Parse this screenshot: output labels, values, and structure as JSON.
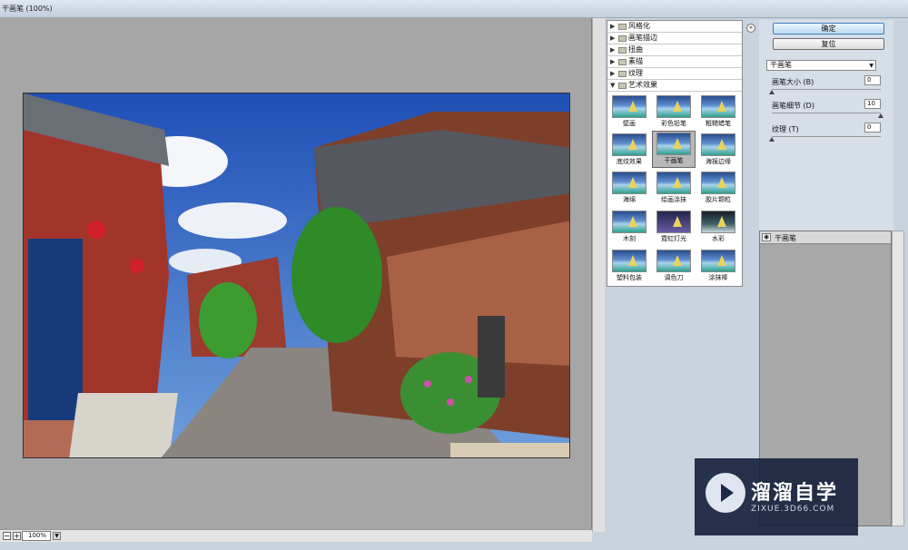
{
  "window": {
    "title": "干画笔 (100%)"
  },
  "zoom": {
    "value": "100%"
  },
  "gallery": {
    "categories": [
      "风格化",
      "画笔描边",
      "扭曲",
      "素描",
      "纹理",
      "艺术效果"
    ],
    "thumbnails": [
      "壁画",
      "彩色铅笔",
      "粗糙蜡笔",
      "底纹效果",
      "干画笔",
      "海报边缘",
      "海绵",
      "绘画涂抹",
      "胶片颗粒",
      "木刻",
      "霓虹灯光",
      "水彩",
      "塑料包装",
      "调色刀",
      "涂抹棒"
    ],
    "selected": "干画笔"
  },
  "buttons": {
    "ok": "确定",
    "reset": "复位"
  },
  "filter_select": {
    "value": "干画笔"
  },
  "params": [
    {
      "label": "画笔大小 (B)",
      "value": "0",
      "fraction": 0
    },
    {
      "label": "画笔细节 (D)",
      "value": "10",
      "fraction": 1
    },
    {
      "label": "纹理 (T)",
      "value": "0",
      "fraction": 0
    }
  ],
  "layer": {
    "label": "干画笔"
  },
  "watermark": {
    "title": "溜溜自学",
    "subtitle": "ZIXUE.3D66.COM"
  }
}
